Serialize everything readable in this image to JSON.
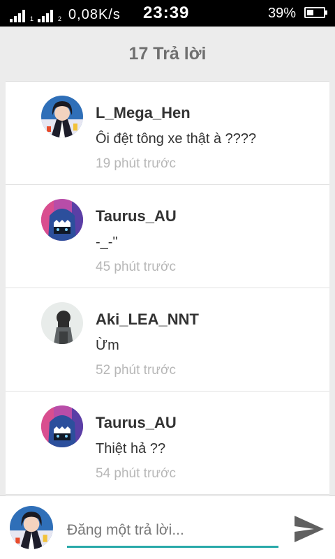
{
  "status_bar": {
    "network_speed": "0,08K/s",
    "time": "23:39",
    "battery_percent": "39%",
    "sim1_label": "1",
    "sim2_label": "2",
    "battery_level": 0.39
  },
  "header": {
    "title": "17 Trả lời"
  },
  "replies": [
    {
      "username": "L_Mega_Hen",
      "message": "Ôi đệt tông xe thật à ????",
      "time": "19 phút trước",
      "avatar_icon": "anime-avatar-1"
    },
    {
      "username": "Taurus_AU",
      "message": "-_-\"",
      "time": "45 phút trước",
      "avatar_icon": "shark-hoodie-avatar"
    },
    {
      "username": "Aki_LEA_NNT",
      "message": "Ừm",
      "time": "52 phút trước",
      "avatar_icon": "girl-avatar"
    },
    {
      "username": "Taurus_AU",
      "message": "Thiệt hả ??",
      "time": "54 phút trước",
      "avatar_icon": "shark-hoodie-avatar"
    }
  ],
  "composer": {
    "placeholder": "Đăng một trả lời...",
    "send_icon": "send-icon"
  },
  "colors": {
    "accent": "#2aa9a9",
    "header_bg": "#ececec",
    "time_text": "#b7b7b7"
  }
}
